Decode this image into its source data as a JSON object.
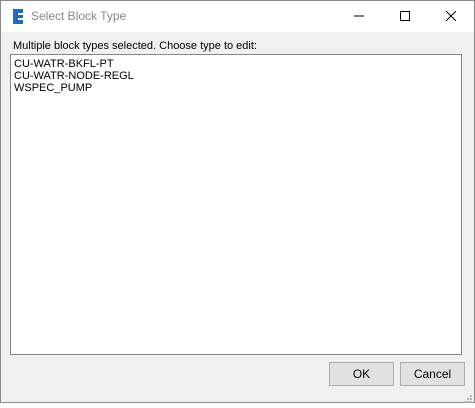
{
  "window": {
    "title": "Select Block Type",
    "app_icon": "civil-app-icon",
    "controls": {
      "minimize_icon": "minimize-icon",
      "maximize_icon": "maximize-icon",
      "close_icon": "close-icon"
    }
  },
  "dialog": {
    "prompt": "Multiple block types selected. Choose type to edit:",
    "block_types": [
      "CU-WATR-BKFL-PT",
      "CU-WATR-NODE-REGL",
      "WSPEC_PUMP"
    ],
    "ok_label": "OK",
    "cancel_label": "Cancel"
  },
  "colors": {
    "accent": "#1a6fc4",
    "title_text": "#888888"
  }
}
